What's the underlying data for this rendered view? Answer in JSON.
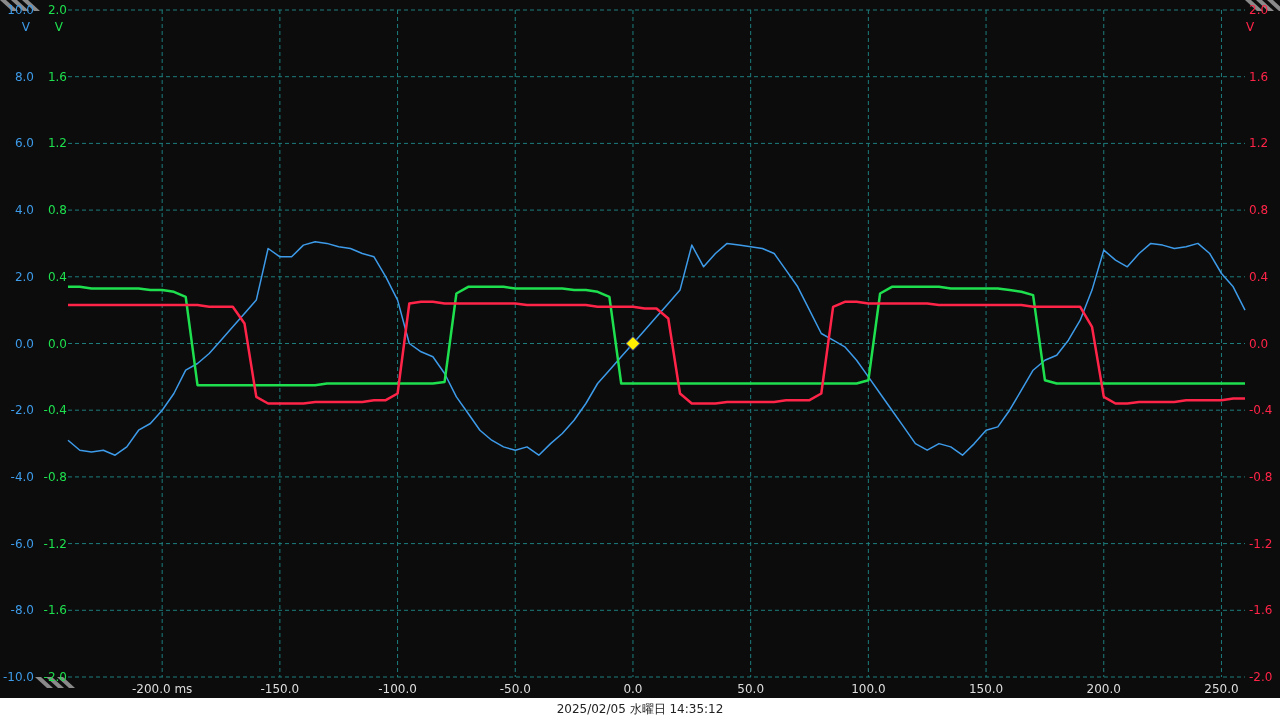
{
  "chart_data": {
    "type": "line",
    "xlim": [
      -240,
      260
    ],
    "x": [
      -240,
      -235,
      -230,
      -225,
      -220,
      -215,
      -210,
      -205,
      -200,
      -195,
      -190,
      -185,
      -180,
      -175,
      -170,
      -165,
      -160,
      -155,
      -150,
      -145,
      -140,
      -135,
      -130,
      -125,
      -120,
      -115,
      -110,
      -105,
      -100,
      -95,
      -90,
      -85,
      -80,
      -75,
      -70,
      -65,
      -60,
      -55,
      -50,
      -45,
      -40,
      -35,
      -30,
      -25,
      -20,
      -15,
      -10,
      -5,
      0,
      5,
      10,
      15,
      20,
      25,
      30,
      35,
      40,
      45,
      50,
      55,
      60,
      65,
      70,
      75,
      80,
      85,
      90,
      95,
      100,
      105,
      110,
      115,
      120,
      125,
      130,
      135,
      140,
      145,
      150,
      155,
      160,
      165,
      170,
      175,
      180,
      185,
      190,
      195,
      200,
      205,
      210,
      215,
      220,
      225,
      230,
      235,
      240,
      245,
      250,
      255,
      260
    ],
    "xticks": [
      {
        "value": -200,
        "label": "-200.0 ms"
      },
      {
        "value": -150,
        "label": "-150.0"
      },
      {
        "value": -100,
        "label": "-100.0"
      },
      {
        "value": -50,
        "label": "-50.0"
      },
      {
        "value": 0,
        "label": "0.0"
      },
      {
        "value": 50,
        "label": "50.0"
      },
      {
        "value": 100,
        "label": "100.0"
      },
      {
        "value": 150,
        "label": "150.0"
      },
      {
        "value": 200,
        "label": "200.0"
      },
      {
        "value": 250,
        "label": "250.0"
      }
    ],
    "ylabel": "V",
    "ylim": [
      -10,
      10
    ],
    "yticks": [
      {
        "value": 10,
        "label": "10.0"
      },
      {
        "value": 8,
        "label": "8.0"
      },
      {
        "value": 6,
        "label": "6.0"
      },
      {
        "value": 4,
        "label": "4.0"
      },
      {
        "value": 2,
        "label": "2.0"
      },
      {
        "value": 0,
        "label": "0.0"
      },
      {
        "value": -2,
        "label": "-2.0"
      },
      {
        "value": -4,
        "label": "-4.0"
      },
      {
        "value": -6,
        "label": "-6.0"
      },
      {
        "value": -8,
        "label": "-8.0"
      },
      {
        "value": -10,
        "label": "-10.0"
      }
    ],
    "y2label": "V",
    "y2lim": [
      -2,
      2
    ],
    "y2ticks": [
      {
        "value": 2,
        "label": "2.0"
      },
      {
        "value": 1.6,
        "label": "1.6"
      },
      {
        "value": 1.2,
        "label": "1.2"
      },
      {
        "value": 0.8,
        "label": "0.8"
      },
      {
        "value": 0.4,
        "label": "0.4"
      },
      {
        "value": 0,
        "label": "0.0"
      },
      {
        "value": -0.4,
        "label": "-0.4"
      },
      {
        "value": -0.8,
        "label": "-0.8"
      },
      {
        "value": -1.2,
        "label": "-1.2"
      },
      {
        "value": -1.6,
        "label": "-1.6"
      },
      {
        "value": -2,
        "label": "-2.0"
      }
    ],
    "y3label": "V",
    "y3lim": [
      -2,
      2
    ],
    "y3ticks": [
      {
        "value": 2,
        "label": "2.0"
      },
      {
        "value": 1.6,
        "label": "1.6"
      },
      {
        "value": 1.2,
        "label": "1.2"
      },
      {
        "value": 0.8,
        "label": "0.8"
      },
      {
        "value": 0.4,
        "label": "0.4"
      },
      {
        "value": 0,
        "label": "0.0"
      },
      {
        "value": -0.4,
        "label": "-0.4"
      },
      {
        "value": -0.8,
        "label": "-0.8"
      },
      {
        "value": -1.2,
        "label": "-1.2"
      },
      {
        "value": -1.6,
        "label": "-1.6"
      },
      {
        "value": -2,
        "label": "-2.0"
      }
    ],
    "series": [
      {
        "color": "#3d9be9",
        "axis": "y",
        "values": [
          -2.9,
          -3.2,
          -3.25,
          -3.2,
          -3.35,
          -3.1,
          -2.6,
          -2.4,
          -2.0,
          -1.5,
          -0.8,
          -0.6,
          -0.3,
          0.1,
          0.5,
          0.9,
          1.3,
          2.85,
          2.6,
          2.6,
          2.95,
          3.05,
          3.0,
          2.9,
          2.85,
          2.7,
          2.6,
          2.0,
          1.3,
          0.0,
          -0.25,
          -0.4,
          -0.9,
          -1.6,
          -2.1,
          -2.6,
          -2.9,
          -3.1,
          -3.2,
          -3.1,
          -3.35,
          -3.0,
          -2.7,
          -2.3,
          -1.8,
          -1.2,
          -0.8,
          -0.4,
          0.0,
          0.4,
          0.8,
          1.2,
          1.6,
          2.95,
          2.3,
          2.7,
          3.0,
          2.95,
          2.9,
          2.85,
          2.7,
          2.2,
          1.7,
          1.0,
          0.3,
          0.1,
          -0.1,
          -0.5,
          -1.0,
          -1.5,
          -2.0,
          -2.5,
          -3.0,
          -3.2,
          -3.0,
          -3.1,
          -3.35,
          -3.0,
          -2.6,
          -2.5,
          -2.0,
          -1.4,
          -0.8,
          -0.5,
          -0.35,
          0.1,
          0.7,
          1.6,
          2.8,
          2.5,
          2.3,
          2.7,
          3.0,
          2.95,
          2.85,
          2.9,
          3.0,
          2.7,
          2.1,
          1.7,
          1.0
        ]
      },
      {
        "color": "#1ee04e",
        "axis": "y2",
        "values": [
          0.34,
          0.34,
          0.33,
          0.33,
          0.33,
          0.33,
          0.33,
          0.32,
          0.32,
          0.31,
          0.28,
          -0.25,
          -0.25,
          -0.25,
          -0.25,
          -0.25,
          -0.25,
          -0.25,
          -0.25,
          -0.25,
          -0.25,
          -0.25,
          -0.24,
          -0.24,
          -0.24,
          -0.24,
          -0.24,
          -0.24,
          -0.24,
          -0.24,
          -0.24,
          -0.24,
          -0.23,
          0.3,
          0.34,
          0.34,
          0.34,
          0.34,
          0.33,
          0.33,
          0.33,
          0.33,
          0.33,
          0.32,
          0.32,
          0.31,
          0.28,
          -0.24,
          -0.24,
          -0.24,
          -0.24,
          -0.24,
          -0.24,
          -0.24,
          -0.24,
          -0.24,
          -0.24,
          -0.24,
          -0.24,
          -0.24,
          -0.24,
          -0.24,
          -0.24,
          -0.24,
          -0.24,
          -0.24,
          -0.24,
          -0.24,
          -0.22,
          0.3,
          0.34,
          0.34,
          0.34,
          0.34,
          0.34,
          0.33,
          0.33,
          0.33,
          0.33,
          0.33,
          0.32,
          0.31,
          0.29,
          -0.22,
          -0.24,
          -0.24,
          -0.24,
          -0.24,
          -0.24,
          -0.24,
          -0.24,
          -0.24,
          -0.24,
          -0.24,
          -0.24,
          -0.24,
          -0.24,
          -0.24,
          -0.24,
          -0.24,
          -0.24
        ]
      },
      {
        "color": "#ff2448",
        "axis": "y3",
        "values": [
          0.23,
          0.23,
          0.23,
          0.23,
          0.23,
          0.23,
          0.23,
          0.23,
          0.23,
          0.23,
          0.23,
          0.23,
          0.22,
          0.22,
          0.22,
          0.12,
          -0.32,
          -0.36,
          -0.36,
          -0.36,
          -0.36,
          -0.35,
          -0.35,
          -0.35,
          -0.35,
          -0.35,
          -0.34,
          -0.34,
          -0.3,
          0.24,
          0.25,
          0.25,
          0.24,
          0.24,
          0.24,
          0.24,
          0.24,
          0.24,
          0.24,
          0.23,
          0.23,
          0.23,
          0.23,
          0.23,
          0.23,
          0.22,
          0.22,
          0.22,
          0.22,
          0.21,
          0.21,
          0.15,
          -0.3,
          -0.36,
          -0.36,
          -0.36,
          -0.35,
          -0.35,
          -0.35,
          -0.35,
          -0.35,
          -0.34,
          -0.34,
          -0.34,
          -0.3,
          0.22,
          0.25,
          0.25,
          0.24,
          0.24,
          0.24,
          0.24,
          0.24,
          0.24,
          0.23,
          0.23,
          0.23,
          0.23,
          0.23,
          0.23,
          0.23,
          0.23,
          0.22,
          0.22,
          0.22,
          0.22,
          0.22,
          0.1,
          -0.32,
          -0.36,
          -0.36,
          -0.35,
          -0.35,
          -0.35,
          -0.35,
          -0.34,
          -0.34,
          -0.34,
          -0.34,
          -0.33,
          -0.33
        ]
      }
    ],
    "grid": true
  },
  "status_bar": {
    "timestamp": "2025/02/05 水曜日 14:35:12"
  }
}
